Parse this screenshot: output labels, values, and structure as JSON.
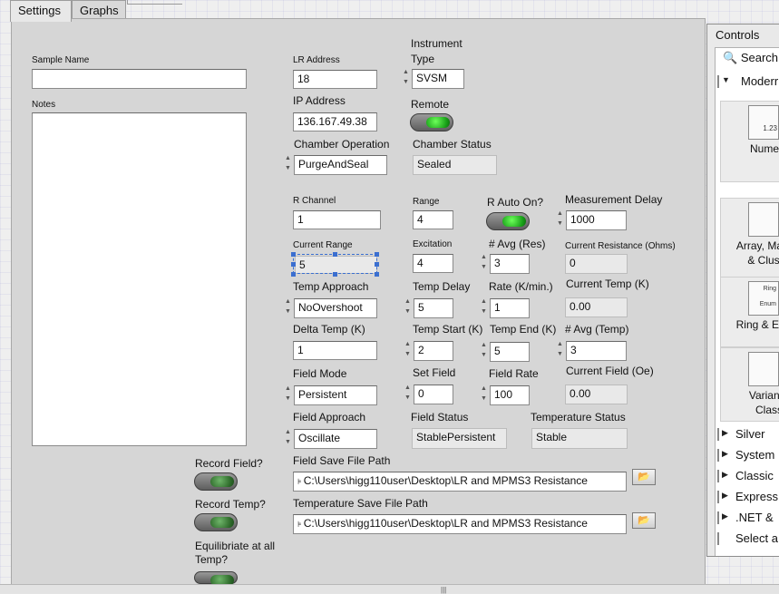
{
  "tabs": [
    "Settings",
    "Graphs"
  ],
  "left": {
    "sample_name_label": "Sample Name",
    "sample_name_value": "",
    "notes_label": "Notes",
    "notes_value": "",
    "record_field_label": "Record Field?",
    "record_temp_label": "Record Temp?",
    "equilibriate_label": "Equilibriate at all Temp?"
  },
  "instrument": {
    "lr_address_label": "LR Address",
    "lr_address_value": "18",
    "instrument_type_label": "Instrument Type",
    "instrument_type_value": "SVSM",
    "ip_address_label": "IP Address",
    "ip_address_value": "136.167.49.38",
    "remote_label": "Remote",
    "chamber_operation_label": "Chamber Operation",
    "chamber_operation_value": "PurgeAndSeal",
    "chamber_status_label": "Chamber Status",
    "chamber_status_value": "Sealed"
  },
  "resistance": {
    "r_channel_label": "R Channel",
    "r_channel_value": "1",
    "range_label": "Range",
    "range_value": "4",
    "r_auto_label": "R Auto On?",
    "measurement_delay_label": "Measurement Delay",
    "measurement_delay_value": "1000",
    "current_range_label": "Current Range",
    "current_range_value": "5",
    "excitation_label": "Excitation",
    "excitation_value": "4",
    "avg_res_label": "# Avg (Res)",
    "avg_res_value": "3",
    "current_resistance_label": "Current Resistance (Ohms)",
    "current_resistance_value": "0"
  },
  "temperature": {
    "temp_approach_label": "Temp Approach",
    "temp_approach_value": "NoOvershoot",
    "temp_delay_label": "Temp Delay",
    "temp_delay_value": "5",
    "rate_label": "Rate (K/min.)",
    "rate_value": "1",
    "current_temp_label": "Current Temp (K)",
    "current_temp_value": "0.00",
    "delta_temp_label": "Delta Temp (K)",
    "delta_temp_value": "1",
    "temp_start_label": "Temp Start (K)",
    "temp_start_value": "2",
    "temp_end_label": "Temp End (K)",
    "temp_end_value": "5",
    "avg_temp_label": "# Avg (Temp)",
    "avg_temp_value": "3"
  },
  "field": {
    "field_mode_label": "Field Mode",
    "field_mode_value": "Persistent",
    "set_field_label": "Set Field",
    "set_field_value": "0",
    "field_rate_label": "Field Rate",
    "field_rate_value": "100",
    "current_field_label": "Current Field (Oe)",
    "current_field_value": "0.00",
    "field_approach_label": "Field Approach",
    "field_approach_value": "Oscillate",
    "field_status_label": "Field Status",
    "field_status_value": "StablePersistent",
    "temperature_status_label": "Temperature Status",
    "temperature_status_value": "Stable"
  },
  "paths": {
    "field_save_label": "Field Save File Path",
    "field_save_value": "C:\\Users\\higg110user\\Desktop\\LR and MPMS3 Resistance",
    "temp_save_label": "Temperature Save File Path",
    "temp_save_value": "C:\\Users\\higg110user\\Desktop\\LR and MPMS3 Resistance"
  },
  "palette": {
    "title": "Controls",
    "search": "Search",
    "modern": "Moderr",
    "categories": [
      "Numer",
      "Array, Ma",
      "& Clust",
      "Ring & Er",
      "Variant",
      "Class"
    ],
    "icon_texts": [
      "1.23",
      "Ring",
      "Enum"
    ],
    "items": [
      "Silver",
      "System",
      "Classic",
      "Express",
      ".NET &",
      "Select a"
    ]
  }
}
